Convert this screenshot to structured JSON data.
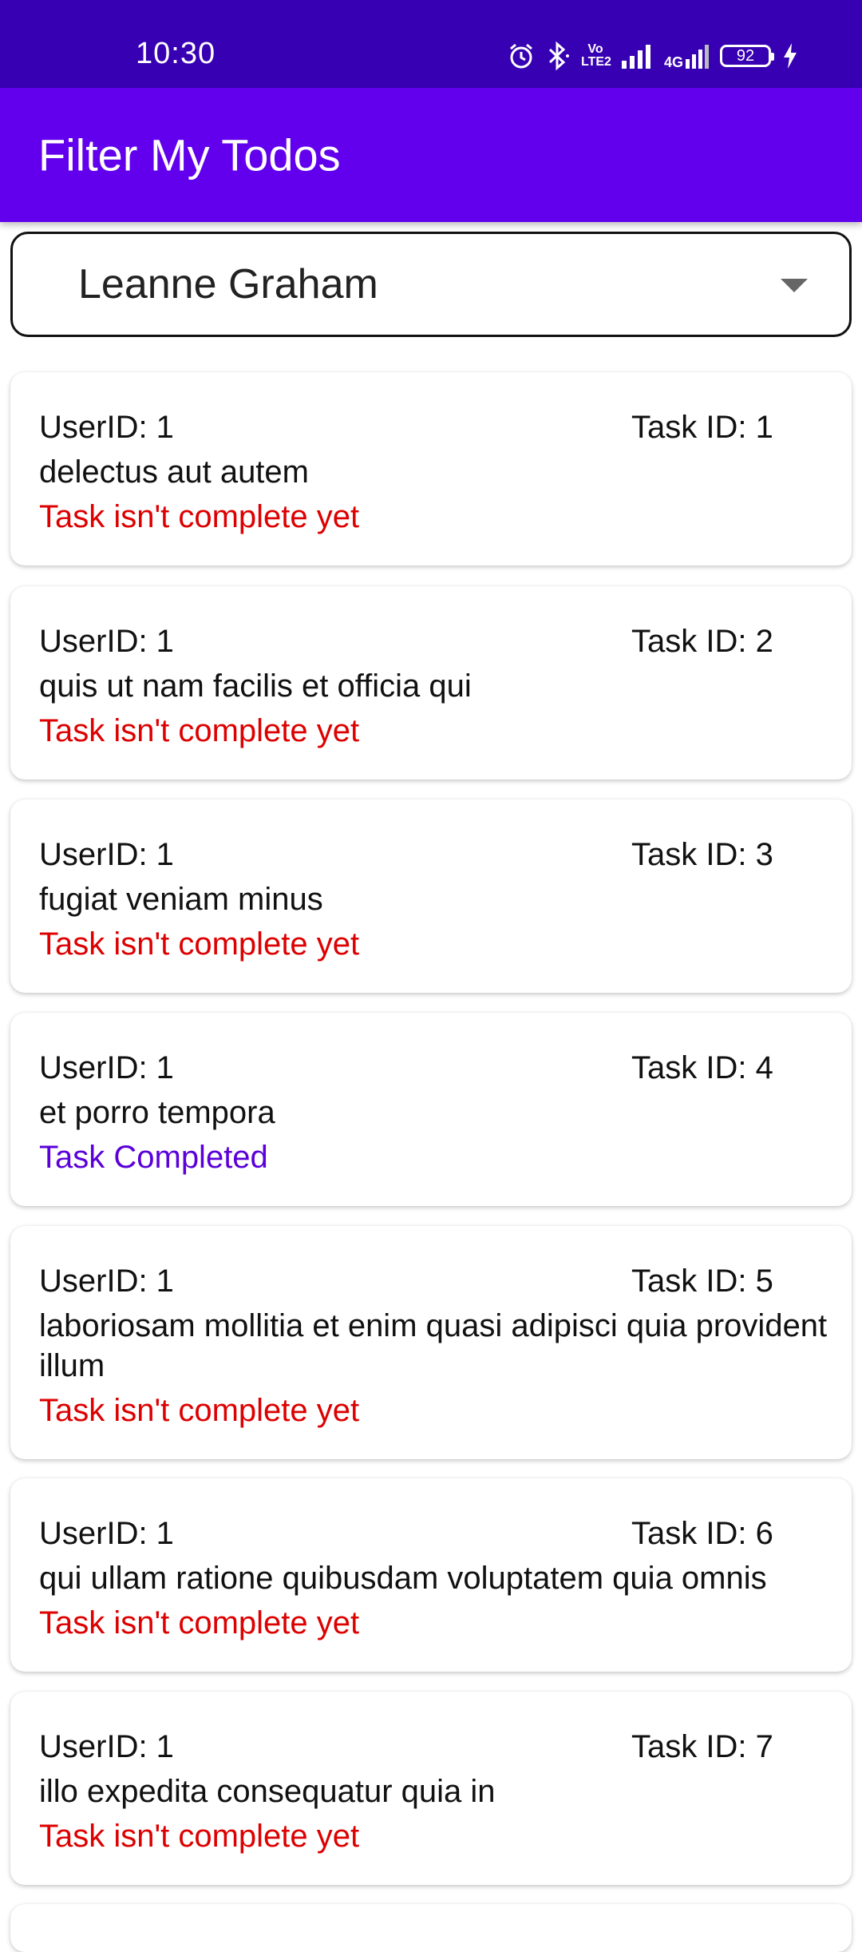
{
  "status_bar": {
    "time": "10:30",
    "battery": "92",
    "volte_label": "Vo LTE2",
    "network_label": "4G"
  },
  "app_bar": {
    "title": "Filter My Todos"
  },
  "dropdown": {
    "selected": "Leanne Graham"
  },
  "colors": {
    "status_bar": "#3700b3",
    "app_bar": "#6200ee",
    "incomplete": "#dd0000",
    "complete": "#5b00d9"
  },
  "todos": [
    {
      "user": "UserID: 1",
      "task": "Task ID: 1",
      "title": "delectus aut autem",
      "status": "Task isn't complete yet",
      "completed": false
    },
    {
      "user": "UserID: 1",
      "task": "Task ID: 2",
      "title": "quis ut nam facilis et officia qui",
      "status": "Task isn't complete yet",
      "completed": false
    },
    {
      "user": "UserID: 1",
      "task": "Task ID: 3",
      "title": "fugiat veniam minus",
      "status": "Task isn't complete yet",
      "completed": false
    },
    {
      "user": "UserID: 1",
      "task": "Task ID: 4",
      "title": "et porro tempora",
      "status": "Task Completed",
      "completed": true
    },
    {
      "user": "UserID: 1",
      "task": "Task ID: 5",
      "title": "laboriosam mollitia et enim quasi adipisci quia provident illum",
      "status": "Task isn't complete yet",
      "completed": false
    },
    {
      "user": "UserID: 1",
      "task": "Task ID: 6",
      "title": "qui ullam ratione quibusdam voluptatem quia omnis",
      "status": "Task isn't complete yet",
      "completed": false
    },
    {
      "user": "UserID: 1",
      "task": "Task ID: 7",
      "title": "illo expedita consequatur quia in",
      "status": "Task isn't complete yet",
      "completed": false
    }
  ]
}
